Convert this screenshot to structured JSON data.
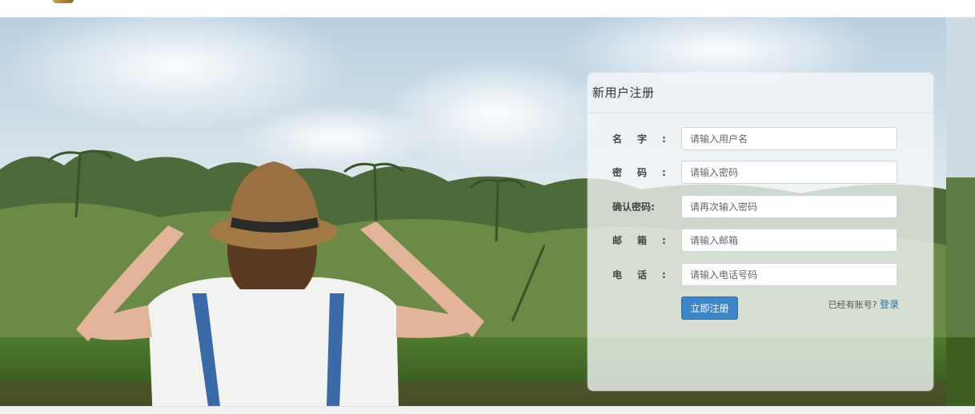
{
  "form": {
    "title": "新用户注册",
    "fields": [
      {
        "label": "名字:",
        "placeholder": "请输入用户名"
      },
      {
        "label": "密码:",
        "placeholder": "请输入密码"
      },
      {
        "label": "确认密码:",
        "placeholder": "请再次输入密码"
      },
      {
        "label": "邮箱:",
        "placeholder": "请输入邮箱"
      },
      {
        "label": "电话:",
        "placeholder": "请输入电话号码"
      }
    ],
    "submit_label": "立即注册",
    "login_prompt": "已经有账号?",
    "login_link": "登录"
  },
  "colors": {
    "accent": "#3a86c8",
    "link": "#2d6fae"
  }
}
